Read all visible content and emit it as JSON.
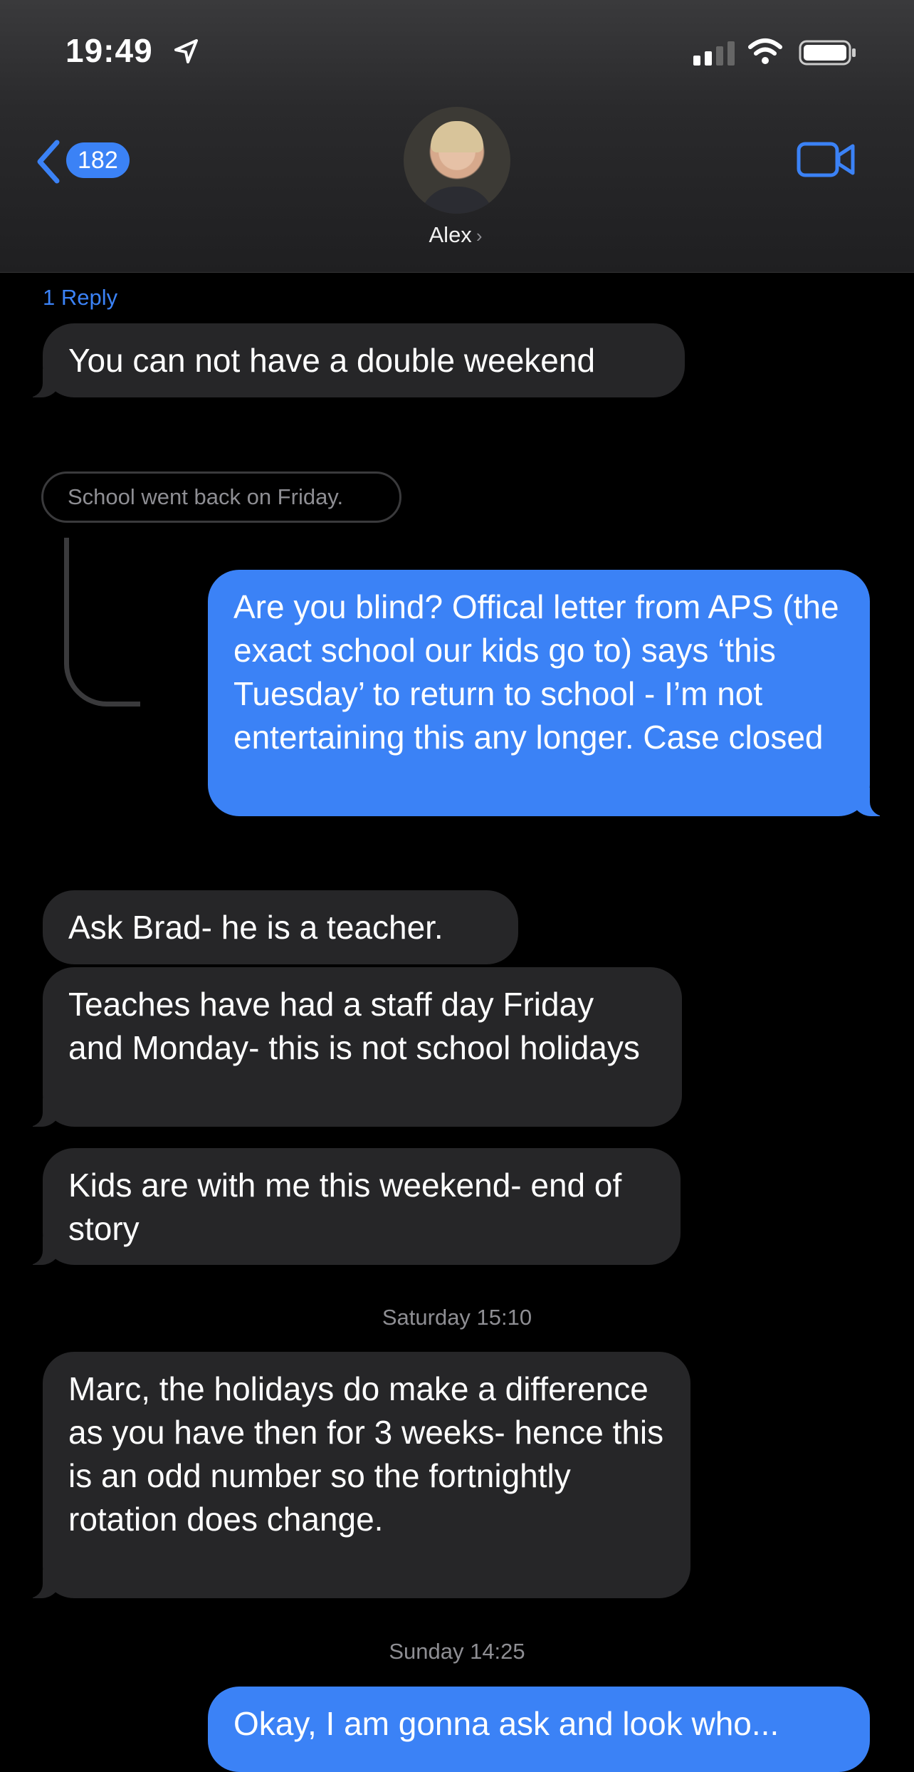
{
  "status_bar": {
    "time": "19:49"
  },
  "header": {
    "back_count": "182",
    "contact_name": "Alex",
    "icons": [
      "chevron-left-icon",
      "video-camera-icon",
      "location-arrow-icon",
      "signal-icon",
      "wifi-icon",
      "battery-icon"
    ]
  },
  "thread": {
    "reply_link": "1 Reply",
    "quoted_message": "School went back on Friday."
  },
  "messages": [
    {
      "from": "contact",
      "text": "You can not have a double weekend"
    },
    {
      "from": "me",
      "text": "Are you blind? Offical letter from APS (the exact school our kids go to) says ‘this Tuesday’ to return to school - I’m not entertaining this any longer. Case closed"
    },
    {
      "from": "contact",
      "text": "Ask Brad- he is a teacher."
    },
    {
      "from": "contact",
      "text": "Teaches have had a staff day Friday and Monday- this is not school holidays"
    },
    {
      "from": "contact",
      "text": "Kids are with me this weekend- end of story"
    },
    {
      "from": "contact",
      "text": "Marc, the holidays do make a difference as you have then for 3 weeks- hence this is an odd number so the fortnightly rotation does change."
    },
    {
      "from": "me",
      "text": "Okay, I am gonna ask and look who..."
    }
  ],
  "timestamps": {
    "saturday": "Saturday 15:10",
    "sunday": "Sunday 14:25"
  },
  "colors": {
    "outgoing_bubble": "#3b82f6",
    "incoming_bubble": "#262628",
    "background": "#000000"
  }
}
